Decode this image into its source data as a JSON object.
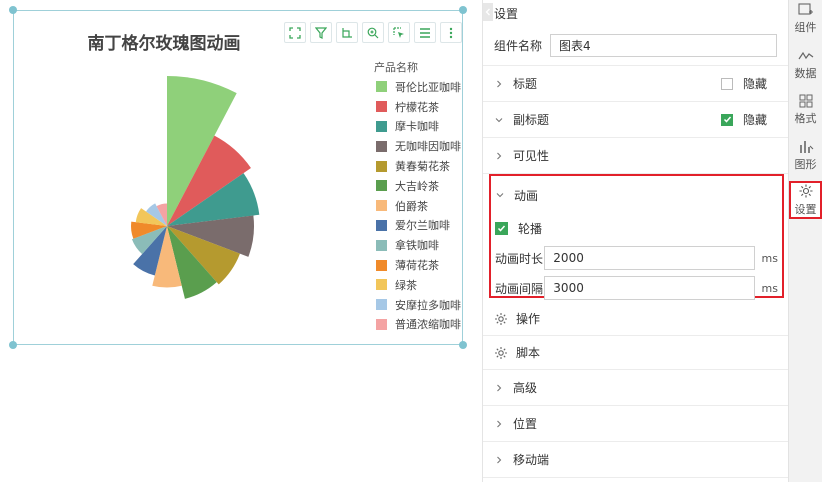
{
  "chart": {
    "title": "南丁格尔玫瑰图动画",
    "legend_title": "产品名称",
    "toolbar": [
      "expand-icon",
      "filter-icon",
      "axis-icon",
      "zoom-icon",
      "select-icon",
      "list-icon",
      "more-icon"
    ]
  },
  "chart_data": {
    "type": "pie",
    "variant": "nightingale-rose",
    "title": "南丁格尔玫瑰图动画",
    "legend_title": "产品名称",
    "legend_position": "right",
    "categories": [
      "哥伦比亚咖啡",
      "柠檬花茶",
      "摩卡咖啡",
      "无咖啡因咖啡",
      "黄春菊花茶",
      "大吉岭茶",
      "伯爵茶",
      "爱尔兰咖啡",
      "拿铁咖啡",
      "薄荷花茶",
      "绿茶",
      "安摩拉多咖啡",
      "普通浓缩咖啡"
    ],
    "values": [
      100,
      68,
      62,
      58,
      52,
      50,
      41,
      34,
      25,
      24,
      21,
      17,
      15
    ],
    "colors": [
      "#8fd07a",
      "#e05b5b",
      "#3f9b8f",
      "#7a6c6c",
      "#b59a2f",
      "#5a9e4e",
      "#f8b97a",
      "#4a72a8",
      "#8bbcb8",
      "#f08a2a",
      "#f2c65a",
      "#a6c8e6",
      "#f4a3a3"
    ]
  },
  "panel": {
    "title": "设置",
    "component_name_label": "组件名称",
    "component_name_value": "图表4",
    "sections": {
      "title": {
        "label": "标题",
        "hide_label": "隐藏",
        "hidden": false
      },
      "subtitle": {
        "label": "副标题",
        "hide_label": "隐藏",
        "hidden": true
      },
      "visibility": {
        "label": "可见性"
      },
      "animation": {
        "label": "动画",
        "carousel_label": "轮播",
        "carousel_on": true,
        "duration_label": "动画时长",
        "duration_value": "2000",
        "interval_label": "动画间隔",
        "interval_value": "3000",
        "unit": "ms"
      },
      "operation": {
        "label": "操作"
      },
      "script": {
        "label": "脚本"
      },
      "advanced": {
        "label": "高级"
      },
      "position": {
        "label": "位置"
      },
      "mobile": {
        "label": "移动端"
      }
    }
  },
  "sidebar": {
    "items": [
      {
        "label": "组件",
        "icon": "component-icon"
      },
      {
        "label": "数据",
        "icon": "data-icon"
      },
      {
        "label": "格式",
        "icon": "format-icon"
      },
      {
        "label": "图形",
        "icon": "graph-icon"
      },
      {
        "label": "设置",
        "icon": "settings-icon",
        "active": true
      }
    ]
  }
}
